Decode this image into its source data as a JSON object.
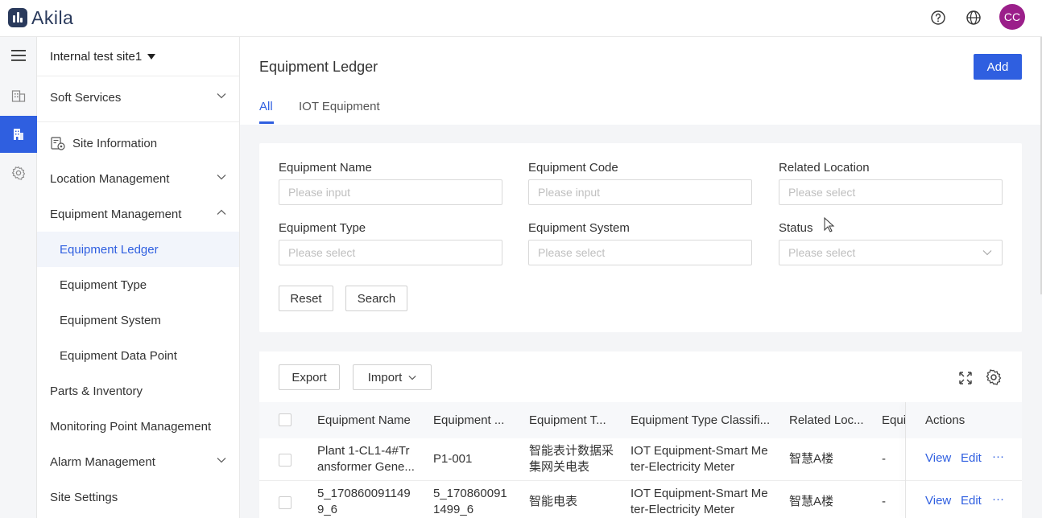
{
  "app": {
    "brand": "Akila",
    "avatar_initials": "CC"
  },
  "site": {
    "name": "Internal test site1"
  },
  "menu": {
    "soft_services": "Soft Services",
    "site_information": "Site Information",
    "location_management": "Location Management",
    "equipment_management": "Equipment Management",
    "equipment_ledger": "Equipment Ledger",
    "equipment_type": "Equipment Type",
    "equipment_system": "Equipment System",
    "equipment_data_point": "Equipment Data Point",
    "parts_inventory": "Parts & Inventory",
    "monitoring_point": "Monitoring Point Management",
    "alarm_management": "Alarm Management",
    "site_settings": "Site Settings"
  },
  "page": {
    "title": "Equipment Ledger",
    "add_label": "Add",
    "tabs": [
      "All",
      "IOT Equipment"
    ]
  },
  "filters": {
    "equipment_name": {
      "label": "Equipment Name",
      "placeholder": "Please input"
    },
    "equipment_code": {
      "label": "Equipment Code",
      "placeholder": "Please input"
    },
    "related_location": {
      "label": "Related Location",
      "placeholder": "Please select"
    },
    "equipment_type": {
      "label": "Equipment Type",
      "placeholder": "Please select"
    },
    "equipment_system": {
      "label": "Equipment System",
      "placeholder": "Please select"
    },
    "status": {
      "label": "Status",
      "placeholder": "Please select"
    },
    "reset_label": "Reset",
    "search_label": "Search"
  },
  "toolbar": {
    "export_label": "Export",
    "import_label": "Import"
  },
  "table": {
    "columns": [
      "Equipment Name",
      "Equipment ...",
      "Equipment T...",
      "Equipment Type Classifi...",
      "Related Loc...",
      "Equi",
      "Actions"
    ],
    "rows": [
      {
        "name": [
          "Plant 1-CL1-4#Tr",
          "ansformer Gene..."
        ],
        "code": [
          "P1-001"
        ],
        "type": [
          "智能表计数据采",
          "集网关电表"
        ],
        "classification": [
          "IOT Equipment-Smart Me",
          "ter-Electricity Meter"
        ],
        "location": "智慧A楼",
        "equi": "-"
      },
      {
        "name": [
          "5_170860091149",
          "9_6"
        ],
        "code": [
          "5_170860091",
          "1499_6"
        ],
        "type": [
          "智能电表"
        ],
        "classification": [
          "IOT Equipment-Smart Me",
          "ter-Electricity Meter"
        ],
        "location": "智慧A楼",
        "equi": "-"
      }
    ],
    "actions": {
      "view": "View",
      "edit": "Edit",
      "more": "···"
    }
  },
  "colors": {
    "accent": "#2f5fe0",
    "avatar": "#9b1f8a",
    "brand": "#2a3a5c"
  }
}
